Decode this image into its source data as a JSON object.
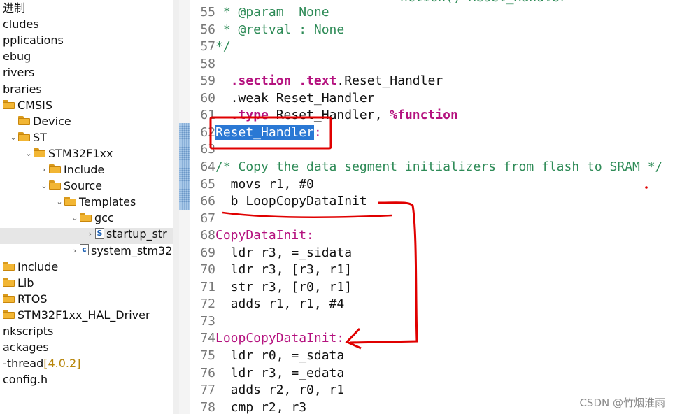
{
  "tree": {
    "items": [
      {
        "label": "进制",
        "depth": 0,
        "chev": "",
        "icon": "none"
      },
      {
        "label": "cludes",
        "depth": 0,
        "chev": "",
        "icon": "none"
      },
      {
        "label": "pplications",
        "depth": 0,
        "chev": "",
        "icon": "none"
      },
      {
        "label": "ebug",
        "depth": 0,
        "chev": "",
        "icon": "none"
      },
      {
        "label": "rivers",
        "depth": 0,
        "chev": "",
        "icon": "none"
      },
      {
        "label": "braries",
        "depth": 0,
        "chev": "",
        "icon": "none"
      },
      {
        "label": "CMSIS",
        "depth": 0,
        "chev": "",
        "icon": "folder"
      },
      {
        "label": "Device",
        "depth": 1,
        "chev": "",
        "icon": "folder"
      },
      {
        "label": "ST",
        "depth": 1,
        "chev": "⌄",
        "icon": "folder"
      },
      {
        "label": "STM32F1xx",
        "depth": 2,
        "chev": "⌄",
        "icon": "folder"
      },
      {
        "label": "Include",
        "depth": 3,
        "chev": "›",
        "icon": "folder"
      },
      {
        "label": "Source",
        "depth": 3,
        "chev": "⌄",
        "icon": "folder"
      },
      {
        "label": "Templates",
        "depth": 4,
        "chev": "⌄",
        "icon": "folder"
      },
      {
        "label": "gcc",
        "depth": 5,
        "chev": "⌄",
        "icon": "folder"
      },
      {
        "label": "startup_str",
        "depth": 6,
        "chev": "›",
        "icon": "file-s"
      },
      {
        "label": "system_stm32",
        "depth": 5,
        "chev": "›",
        "icon": "file-c"
      },
      {
        "label": "Include",
        "depth": 0,
        "chev": "",
        "icon": "folder"
      },
      {
        "label": "Lib",
        "depth": 0,
        "chev": "",
        "icon": "folder"
      },
      {
        "label": "RTOS",
        "depth": 0,
        "chev": "",
        "icon": "folder"
      },
      {
        "label": "STM32F1xx_HAL_Driver",
        "depth": 0,
        "chev": "",
        "icon": "folder"
      },
      {
        "label": "nkscripts",
        "depth": 0,
        "chev": "",
        "icon": "none"
      },
      {
        "label": "ackages",
        "depth": 0,
        "chev": "",
        "icon": "none"
      },
      {
        "label": "-thread",
        "depth": 0,
        "chev": "",
        "icon": "none",
        "version": "[4.0.2]"
      },
      {
        "label": "config.h",
        "depth": 0,
        "chev": "",
        "icon": "none"
      }
    ],
    "file_icon_glyphs": {
      "file-s": "S",
      "file-c": "c"
    }
  },
  "editor": {
    "top_fragment": "nction() Reset_Handler",
    "lines": [
      {
        "n": "55",
        "code": " * @param  None",
        "style": "cm"
      },
      {
        "n": "56",
        "code": " * @retval : None",
        "style": "cm"
      },
      {
        "n": "57",
        "code": "*/",
        "style": "cm"
      },
      {
        "n": "58",
        "code": "",
        "style": ""
      },
      {
        "n": "59",
        "code": "  .section .text.Reset_Handler",
        "style": "section"
      },
      {
        "n": "60",
        "code": "  .weak Reset_Handler",
        "style": ""
      },
      {
        "n": "61",
        "code": "  .type Reset_Handler, %function",
        "style": "type"
      },
      {
        "n": "62",
        "code": "Reset_Handler:",
        "style": "label-sel"
      },
      {
        "n": "63",
        "code": "",
        "style": ""
      },
      {
        "n": "64",
        "code": "/* Copy the data segment initializers from flash to SRAM */",
        "style": "cm"
      },
      {
        "n": "65",
        "code": "  movs r1, #0",
        "style": ""
      },
      {
        "n": "66",
        "code": "  b LoopCopyDataInit",
        "style": ""
      },
      {
        "n": "67",
        "code": "",
        "style": ""
      },
      {
        "n": "68",
        "code": "CopyDataInit:",
        "style": "label"
      },
      {
        "n": "69",
        "code": "  ldr r3, =_sidata",
        "style": ""
      },
      {
        "n": "70",
        "code": "  ldr r3, [r3, r1]",
        "style": ""
      },
      {
        "n": "71",
        "code": "  str r3, [r0, r1]",
        "style": ""
      },
      {
        "n": "72",
        "code": "  adds r1, r1, #4",
        "style": ""
      },
      {
        "n": "73",
        "code": "",
        "style": ""
      },
      {
        "n": "74",
        "code": "LoopCopyDataInit:",
        "style": "label"
      },
      {
        "n": "75",
        "code": "  ldr r0, =_sdata",
        "style": ""
      },
      {
        "n": "76",
        "code": "  ldr r3, =_edata",
        "style": ""
      },
      {
        "n": "77",
        "code": "  adds r2, r0, r1",
        "style": ""
      },
      {
        "n": "78",
        "code": "  cmp r2, r3",
        "style": ""
      }
    ]
  },
  "watermark": "CSDN @竹烟淮雨",
  "colors": {
    "comment": "#2e8b57",
    "keyword": "#b5127f",
    "selection": "#2a78d4",
    "annotation": "#e00000",
    "folder": "#f2b634"
  }
}
